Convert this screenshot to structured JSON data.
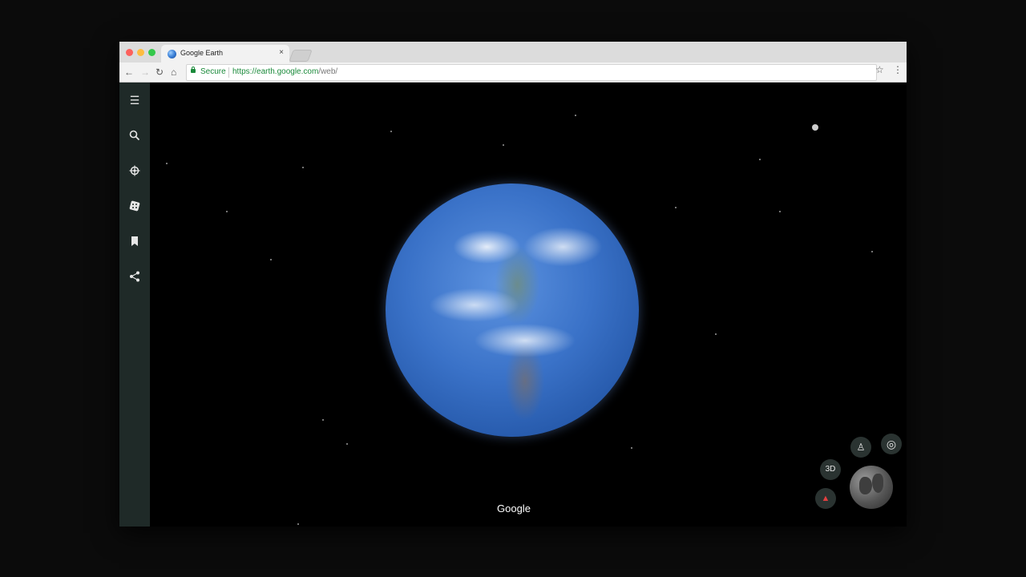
{
  "browser": {
    "tab_title": "Google Earth",
    "tab_close": "×",
    "secure_label": "Secure",
    "url_scheme_host": "https://earth.google.com",
    "url_path": "/web/"
  },
  "sidebar": {
    "items": [
      {
        "icon": "menu-icon"
      },
      {
        "icon": "search-icon"
      },
      {
        "icon": "voyager-icon"
      },
      {
        "icon": "feeling-lucky-icon"
      },
      {
        "icon": "projects-icon"
      },
      {
        "icon": "share-icon"
      }
    ]
  },
  "map": {
    "logo": "Google",
    "btn_3d": "3D"
  }
}
